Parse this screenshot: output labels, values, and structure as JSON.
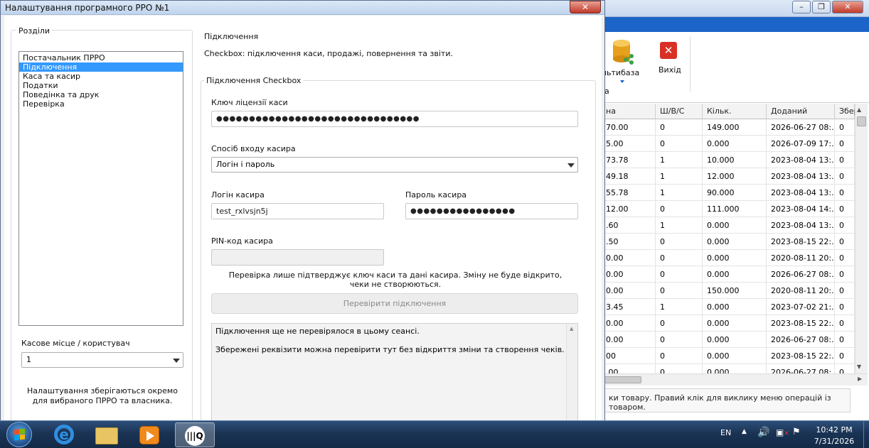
{
  "dialog": {
    "title": "Налаштування програмного РРО №1",
    "close_label": "✕"
  },
  "sections_group": {
    "legend": "Розділи",
    "items": [
      {
        "label": "Постачальник ПРРО",
        "selected": false
      },
      {
        "label": "Підключення",
        "selected": true
      },
      {
        "label": "Каса та касир",
        "selected": false
      },
      {
        "label": "Податки",
        "selected": false
      },
      {
        "label": "Поведінка та друк",
        "selected": false
      },
      {
        "label": "Перевірка",
        "selected": false
      }
    ],
    "workplace_label": "Касове місце / користувач",
    "workplace_value": "1",
    "note": "Налаштування зберігаються окремо для вибраного ПРРО та власника."
  },
  "page": {
    "heading": "Підключення",
    "description": "Checkbox: підключення каси, продажі, повернення та звіти."
  },
  "checkbox_group": {
    "legend": "Підключення Checkbox",
    "license_key_label": "Ключ ліцензії каси",
    "license_key_value": "●●●●●●●●●●●●●●●●●●●●●●●●●●●●●●●",
    "login_method_label": "Спосіб входу касира",
    "login_method_value": "Логін і пароль",
    "cashier_login_label": "Логін касира",
    "cashier_login_value": "test_rxlvsjn5j",
    "cashier_password_label": "Пароль касира",
    "cashier_password_value": "●●●●●●●●●●●●●●●●",
    "pin_label": "PIN-код касира",
    "pin_value": "",
    "check_note": "Перевірка лише підтверджує ключ каси та дані касира. Зміну не буде відкрито, чеки не створюються.",
    "check_button": "Перевірити підключення",
    "log_line1": "Підключення ще не перевірялося в цьому сеансі.",
    "log_line2": "Збережені реквізити можна перевірити тут без відкриття зміни та створення чеків."
  },
  "bg_app": {
    "ribbon_multibase": "льтибаза",
    "ribbon_exit": "Вихід",
    "ribbon_small": "а",
    "columns": [
      "на",
      "Ш/В/С",
      "Кільк.",
      "Доданий",
      "Збер"
    ],
    "rows": [
      [
        "70.00",
        "0",
        "149.000",
        "2026-06-27 08:...",
        "0"
      ],
      [
        "5.00",
        "0",
        "0.000",
        "2026-07-09 17:...",
        "0"
      ],
      [
        "73.78",
        "1",
        "10.000",
        "2023-08-04 13:...",
        "0"
      ],
      [
        "49.18",
        "1",
        "12.000",
        "2023-08-04 13:...",
        "0"
      ],
      [
        "55.78",
        "1",
        "90.000",
        "2023-08-04 13:...",
        "0"
      ],
      [
        "12.00",
        "0",
        "111.000",
        "2023-08-04 14:...",
        "0"
      ],
      [
        ".60",
        "1",
        "0.000",
        "2023-08-04 13:...",
        "0"
      ],
      [
        ".50",
        "0",
        "0.000",
        "2023-08-15 22:...",
        "0"
      ],
      [
        "0.00",
        "0",
        "0.000",
        "2020-08-11 20:...",
        "0"
      ],
      [
        "0.00",
        "0",
        "0.000",
        "2026-06-27 08:...",
        "0"
      ],
      [
        "0.00",
        "0",
        "150.000",
        "2020-08-11 20:...",
        "0"
      ],
      [
        "3.45",
        "1",
        "0.000",
        "2023-07-02 21:...",
        "0"
      ],
      [
        "0.00",
        "0",
        "0.000",
        "2023-08-15 22:...",
        "0"
      ],
      [
        "0.00",
        "0",
        "0.000",
        "2026-06-27 08:...",
        "0"
      ],
      [
        "00",
        "0",
        "0.000",
        "2023-08-15 22:...",
        "0"
      ],
      [
        ".00",
        "0",
        "0.000",
        "2026-06-27 08:...",
        "0"
      ]
    ],
    "status_text": "ки товару. Правий клік для виклику меню операцій із товаром."
  },
  "taskbar": {
    "lang": "EN",
    "time": "10:42 PM",
    "date": "7/31/2026"
  }
}
